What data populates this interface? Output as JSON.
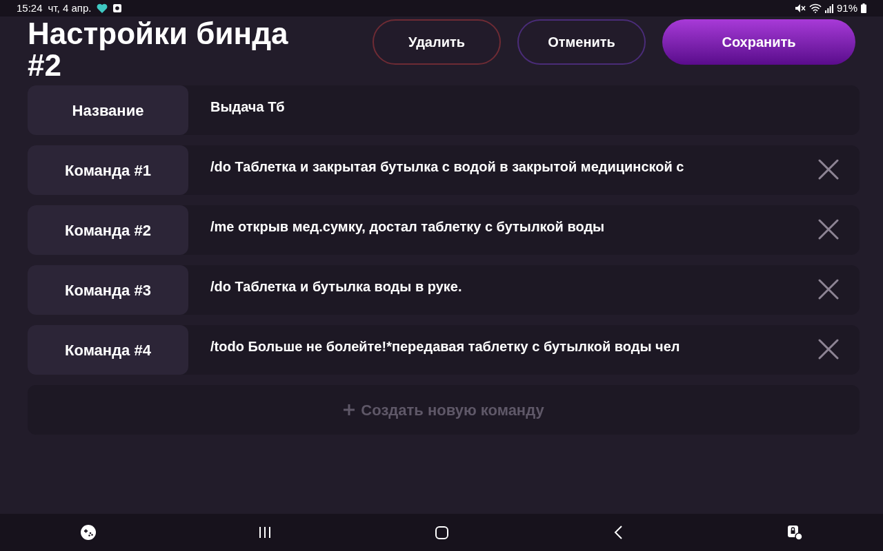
{
  "status_bar": {
    "time": "15:24",
    "date": "чт, 4 апр.",
    "battery": "91%"
  },
  "header": {
    "title": "Настройки бинда #2",
    "buttons": [
      {
        "label": "Удалить",
        "kind": "danger"
      },
      {
        "label": "Отменить",
        "kind": "outline"
      },
      {
        "label": "Сохранить",
        "kind": "primary"
      }
    ]
  },
  "fields": [
    {
      "kind": "name",
      "label": "Название",
      "value": "Выдача Тб"
    },
    {
      "kind": "command",
      "label": "Команда #1",
      "value": "/do Таблетка и закрытая бутылка с водой в закрытой медицинской с"
    },
    {
      "kind": "command",
      "label": "Команда #2",
      "value": "/me открыв мед.сумку, достал таблетку с бутылкой воды"
    },
    {
      "kind": "command",
      "label": "Команда #3",
      "value": "/do Таблетка и бутылка воды в руке."
    },
    {
      "kind": "command",
      "label": "Команда #4",
      "value": "/todo Больше не болейте!*передавая таблетку с бутылкой воды чел"
    }
  ],
  "add_button": {
    "label": "Создать новую команду"
  }
}
